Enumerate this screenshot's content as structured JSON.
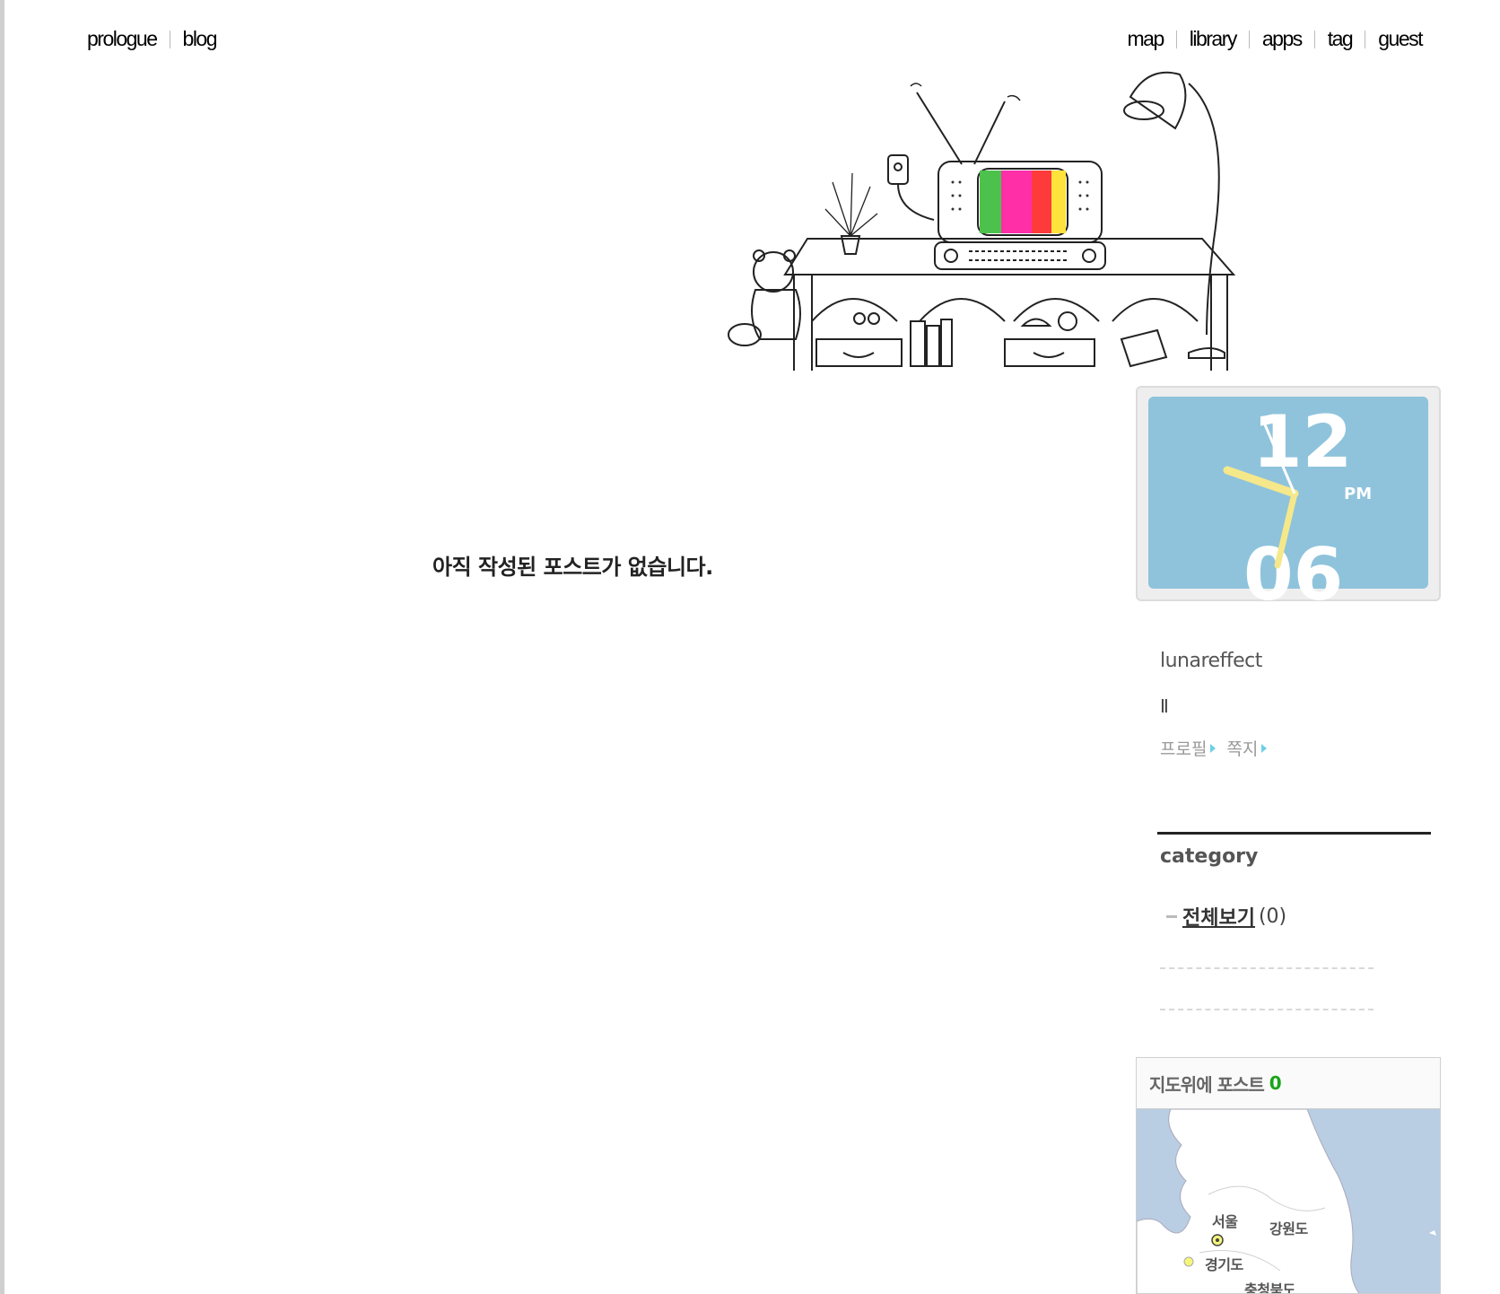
{
  "nav": {
    "left": [
      "prologue",
      "blog"
    ],
    "right": [
      "map",
      "library",
      "apps",
      "tag",
      "guest"
    ]
  },
  "main": {
    "empty_message": "아직 작성된 포스트가 없습니다."
  },
  "clock": {
    "top_hour": "12",
    "bottom_hour": "06",
    "period": "PM",
    "face_color": "#8fc3dc",
    "hand_color": "#f5e88a"
  },
  "profile": {
    "name": "lunareffect",
    "pause_symbol": "Ⅱ",
    "links": [
      "프로필",
      "쪽지"
    ]
  },
  "category": {
    "title": "category",
    "items": [
      {
        "label": "전체보기 ",
        "count": "(0)"
      }
    ]
  },
  "map_widget": {
    "title": "지도위에 포스트",
    "count": "0",
    "labels": [
      "서울",
      "강원도",
      "경기도",
      "충청북도"
    ],
    "sea_color": "#b9cde3"
  }
}
